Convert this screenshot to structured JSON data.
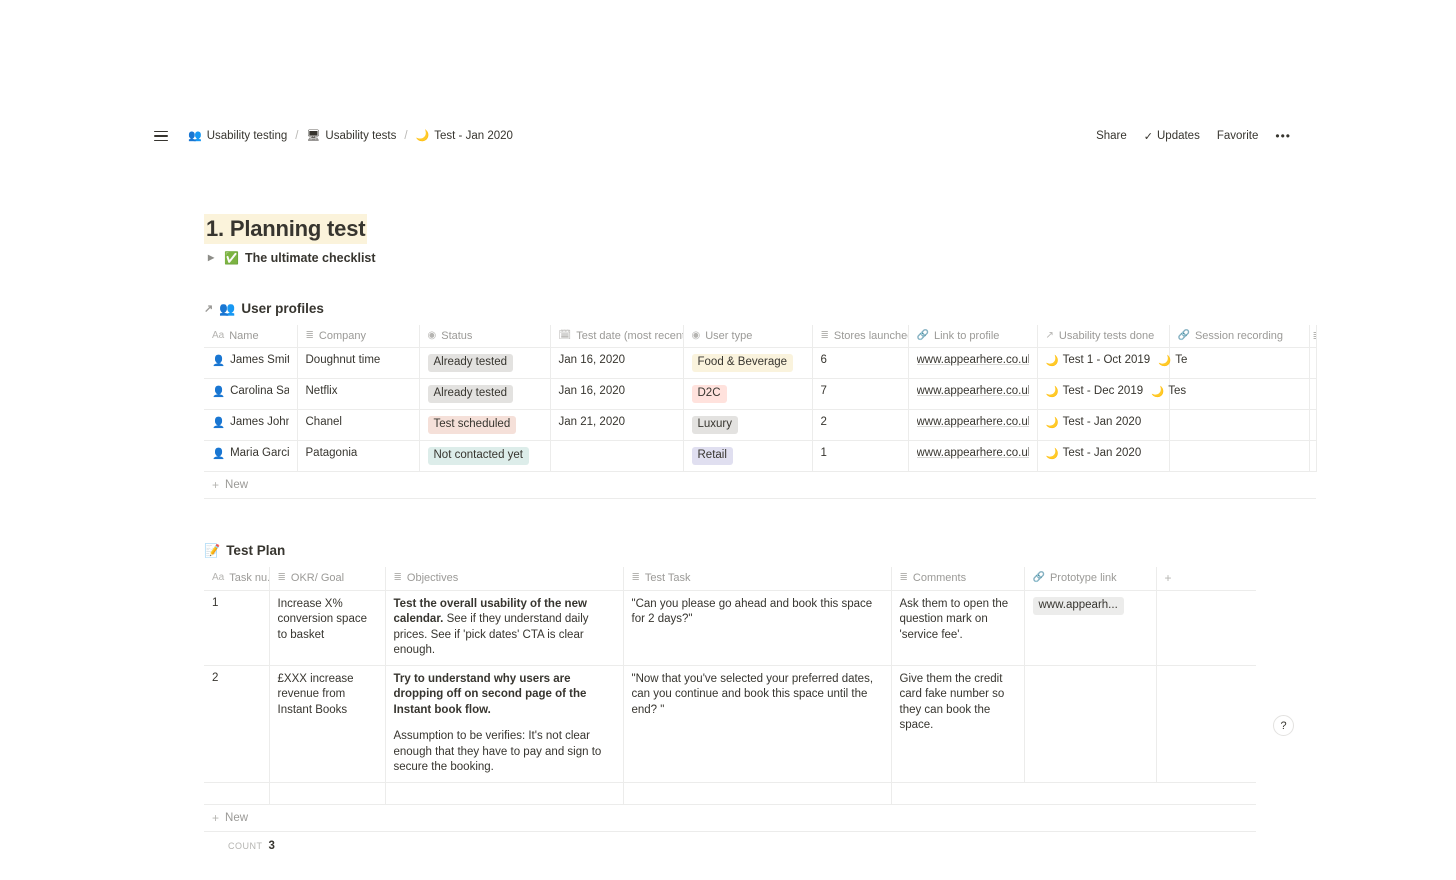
{
  "topbar": {
    "menu_icon": "hamburger-icon",
    "breadcrumbs": [
      {
        "icon": "👥",
        "label": "Usability testing"
      },
      {
        "icon": "🖥",
        "label": "Usability tests"
      },
      {
        "icon": "🌙",
        "label": "Test - Jan 2020"
      }
    ],
    "separator": "/",
    "actions": {
      "share": "Share",
      "updates": "Updates",
      "updates_icon": "check-icon",
      "favorite": "Favorite",
      "more": "•••"
    }
  },
  "page": {
    "heading": "1. Planning test",
    "heading_highlight": "#fbf3db",
    "toggle": {
      "arrow": "▶",
      "emoji": "✅",
      "label": "The ultimate checklist"
    }
  },
  "user_profiles": {
    "link_arrow": "↗",
    "emoji": "👥",
    "title": "User profiles",
    "columns": [
      {
        "icon": "Aa",
        "label": "Name"
      },
      {
        "icon": "≣",
        "label": "Company"
      },
      {
        "icon": "◉",
        "label": "Status"
      },
      {
        "icon": "🗓",
        "label": "Test date (most recent)"
      },
      {
        "icon": "◉",
        "label": "User type"
      },
      {
        "icon": "≣",
        "label": "Stores launched"
      },
      {
        "icon": "🔗",
        "label": "Link to profile"
      },
      {
        "icon": "↗",
        "label": "Usability tests done"
      },
      {
        "icon": "🔗",
        "label": "Session recording"
      },
      {
        "icon": "≣",
        "label": ""
      }
    ],
    "rows": [
      {
        "emoji": "👤",
        "name": "James Smith",
        "company": "Doughnut time",
        "status": "Already tested",
        "status_bg": "#e3e2e0",
        "status_fg": "#37352f",
        "test_date": "Jan 16, 2020",
        "user_type": "Food & Beverage",
        "user_type_bg": "#faf3dd",
        "user_type_fg": "#37352f",
        "stores_launched": "6",
        "link": "www.appearhere.co.uk/idea-",
        "tests": [
          "Test 1 - Oct 2019",
          "Te"
        ],
        "session_recording": ""
      },
      {
        "emoji": "👤",
        "name": "Carolina Sant",
        "company": "Netflix",
        "status": "Already tested",
        "status_bg": "#e3e2e0",
        "status_fg": "#37352f",
        "test_date": "Jan 16, 2020",
        "user_type": "D2C",
        "user_type_bg": "#ffe2dd",
        "user_type_fg": "#37352f",
        "stores_launched": "7",
        "link": "www.appearhere.co.uk/idea-",
        "tests": [
          "Test - Dec 2019",
          "Tes"
        ],
        "session_recording": ""
      },
      {
        "emoji": "👤",
        "name": "James Johnso",
        "company": "Chanel",
        "status": "Test scheduled",
        "status_bg": "#f5e0d9",
        "status_fg": "#37352f",
        "test_date": "Jan 21, 2020",
        "user_type": "Luxury",
        "user_type_bg": "#e3e2e0",
        "user_type_fg": "#37352f",
        "stores_launched": "2",
        "link": "www.appearhere.co.uk/idea-",
        "tests": [
          "Test - Jan 2020"
        ],
        "session_recording": ""
      },
      {
        "emoji": "👤",
        "name": "Maria Garcia",
        "company": "Patagonia",
        "status": "Not contacted yet",
        "status_bg": "#ddedea",
        "status_fg": "#37352f",
        "test_date": "",
        "user_type": "Retail",
        "user_type_bg": "#e0dff0",
        "user_type_fg": "#37352f",
        "stores_launched": "1",
        "link": "www.appearhere.co.uk/idea-",
        "tests": [
          "Test - Jan 2020"
        ],
        "session_recording": ""
      }
    ],
    "new_label": "New"
  },
  "test_plan": {
    "emoji": "📝",
    "title": "Test Plan",
    "columns": [
      {
        "icon": "Aa",
        "label": "Task nu..."
      },
      {
        "icon": "≣",
        "label": "OKR/ Goal"
      },
      {
        "icon": "≣",
        "label": "Objectives"
      },
      {
        "icon": "≣",
        "label": "Test Task"
      },
      {
        "icon": "≣",
        "label": "Comments"
      },
      {
        "icon": "🔗",
        "label": "Prototype link"
      },
      {
        "icon": "+",
        "label": ""
      }
    ],
    "rows": [
      {
        "task_number": "1",
        "okr_goal": "Increase X% conversion space to basket",
        "objective_bold": "Test the overall usability of the new calendar.",
        "objective_rest": "See if they understand daily prices. See if 'pick dates' CTA is clear enough.",
        "objective_extra": "",
        "test_task": "\"Can you please go ahead and book this space for 2 days?\"",
        "comments": "Ask them to open the question mark on 'service fee'.",
        "prototype_link": "www.appearh...",
        "prototype_link_bg": "#ececeb"
      },
      {
        "task_number": "2",
        "okr_goal": "£XXX increase revenue from Instant Books",
        "objective_bold": "Try to understand why users are dropping off on second page of the Instant book flow.",
        "objective_rest": "",
        "objective_extra": "Assumption to be verifies: It's not clear enough that they have to pay and sign to secure the booking.",
        "test_task": "\"Now that you've selected your preferred dates, can you continue and book this space until the end? \"",
        "comments": "Give them the credit card fake number so they can book the space.",
        "prototype_link": "",
        "prototype_link_bg": "#ececeb"
      },
      {
        "task_number": "",
        "okr_goal": "",
        "objective_bold": "",
        "objective_rest": "",
        "objective_extra": "",
        "test_task": "",
        "comments": "",
        "prototype_link": ""
      }
    ],
    "new_label": "New",
    "count_label": "Count",
    "count_value": "3"
  },
  "help": {
    "glyph": "?"
  }
}
